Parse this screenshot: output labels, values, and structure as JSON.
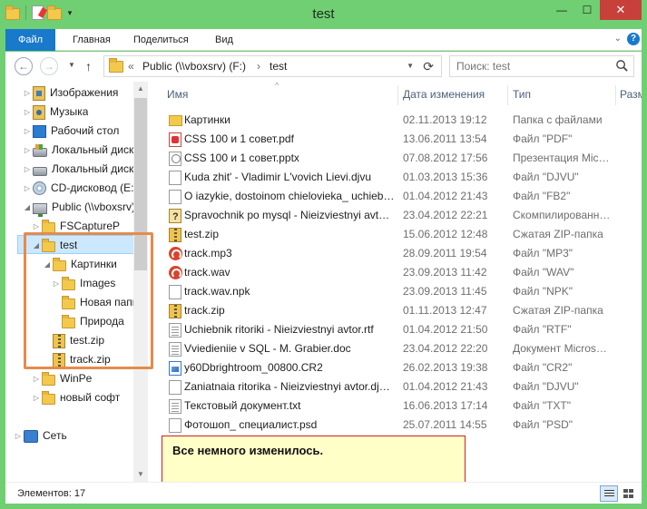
{
  "window": {
    "title": "test",
    "minimize": "—",
    "maximize": "☐",
    "close": "✕"
  },
  "ribbon": {
    "tabs": [
      "Файл",
      "Главная",
      "Поделиться",
      "Вид"
    ],
    "help": "?"
  },
  "address": {
    "prefix": "«",
    "segments": [
      "Public (\\\\vboxsrv) (F:)",
      "test"
    ],
    "separator": "›"
  },
  "search": {
    "placeholder": "Поиск: test"
  },
  "tree": [
    {
      "label": "Изображения",
      "icon": "pictures-library-icon",
      "arrow": "▷",
      "level": 1
    },
    {
      "label": "Музыка",
      "icon": "music-library-icon",
      "arrow": "▷",
      "level": 1
    },
    {
      "label": "Рабочий стол",
      "icon": "desktop-icon",
      "arrow": "▷",
      "level": 1
    },
    {
      "label": "Локальный диск",
      "icon": "local-disk-icon",
      "arrow": "▷",
      "level": 1
    },
    {
      "label": "Локальный диск",
      "icon": "local-disk-icon",
      "arrow": "▷",
      "level": 1
    },
    {
      "label": "CD-дисковод (E:)",
      "icon": "cd-drive-icon",
      "arrow": "▷",
      "level": 1
    },
    {
      "label": "Public (\\\\vboxsrv)",
      "icon": "network-drive-icon",
      "arrow": "◢",
      "level": 1
    },
    {
      "label": "FSCaptureP",
      "icon": "folder-icon",
      "arrow": "▷",
      "level": 2
    },
    {
      "label": "test",
      "icon": "folder-icon",
      "arrow": "◢",
      "level": 2
    },
    {
      "label": "Картинки",
      "icon": "folder-icon",
      "arrow": "◢",
      "level": 3
    },
    {
      "label": "Images",
      "icon": "folder-icon",
      "arrow": "▷",
      "level": 4
    },
    {
      "label": "Новая папка",
      "icon": "folder-icon",
      "arrow": "",
      "level": 4
    },
    {
      "label": "Природа",
      "icon": "folder-icon",
      "arrow": "",
      "level": 4
    },
    {
      "label": "test.zip",
      "icon": "zip-icon",
      "arrow": "",
      "level": 3
    },
    {
      "label": "track.zip",
      "icon": "zip-icon",
      "arrow": "",
      "level": 3
    },
    {
      "label": "WinPe",
      "icon": "folder-icon",
      "arrow": "▷",
      "level": 2
    },
    {
      "label": "новый софт",
      "icon": "folder-icon",
      "arrow": "▷",
      "level": 2
    },
    {
      "label": "Сеть",
      "icon": "network-icon",
      "arrow": "▷",
      "level": 0
    }
  ],
  "columns": {
    "name": "Имя",
    "date": "Дата изменения",
    "type": "Тип",
    "size": "Разм"
  },
  "files": [
    {
      "name": "Картинки",
      "date": "02.11.2013 19:12",
      "type": "Папка с файлами",
      "icon": "folder-icon"
    },
    {
      "name": "CSS 100 и 1 совет.pdf",
      "date": "13.06.2011 13:54",
      "type": "Файл \"PDF\"",
      "icon": "pdf-icon"
    },
    {
      "name": "CSS 100 и 1 совет.pptx",
      "date": "07.08.2012 17:56",
      "type": "Презентация Mic…",
      "icon": "pptx-icon"
    },
    {
      "name": "Kuda zhit' - Vladimir L'vovich Lievi.djvu",
      "date": "01.03.2013 15:36",
      "type": "Файл \"DJVU\"",
      "icon": "document-icon"
    },
    {
      "name": "O iazykie, dostoinom chielovieka_ uchieb…",
      "date": "01.04.2012 21:43",
      "type": "Файл \"FB2\"",
      "icon": "document-icon"
    },
    {
      "name": "Spravochnik po mysql - Nieizviestnyi avt…",
      "date": "23.04.2012 22:21",
      "type": "Скомпилированн…",
      "icon": "chm-help-icon"
    },
    {
      "name": "test.zip",
      "date": "15.06.2012 12:48",
      "type": "Сжатая ZIP-папка",
      "icon": "zip-icon"
    },
    {
      "name": "track.mp3",
      "date": "28.09.2011 19:54",
      "type": "Файл \"MP3\"",
      "icon": "audio-icon"
    },
    {
      "name": "track.wav",
      "date": "23.09.2013 11:42",
      "type": "Файл \"WAV\"",
      "icon": "audio-icon"
    },
    {
      "name": "track.wav.npk",
      "date": "23.09.2013 11:45",
      "type": "Файл \"NPK\"",
      "icon": "document-icon"
    },
    {
      "name": "track.zip",
      "date": "01.11.2013 12:47",
      "type": "Сжатая ZIP-папка",
      "icon": "zip-icon"
    },
    {
      "name": "Uchiebnik ritoriki - Nieizviestnyi avtor.rtf",
      "date": "01.04.2012 21:50",
      "type": "Файл \"RTF\"",
      "icon": "rtf-icon"
    },
    {
      "name": "Vviedieniie v SQL - M. Grabier.doc",
      "date": "23.04.2012 22:20",
      "type": "Документ Micros…",
      "icon": "rtf-icon"
    },
    {
      "name": "y60Dbrightroom_00800.CR2",
      "date": "26.02.2013 19:38",
      "type": "Файл \"CR2\"",
      "icon": "image-icon"
    },
    {
      "name": "Zaniatnaia ritorika - Nieizviestnyi avtor.dj…",
      "date": "01.04.2012 21:43",
      "type": "Файл \"DJVU\"",
      "icon": "document-icon"
    },
    {
      "name": "Текстовый документ.txt",
      "date": "16.06.2013 17:14",
      "type": "Файл \"TXT\"",
      "icon": "rtf-icon"
    },
    {
      "name": "Фотошоп_ специалист.psd",
      "date": "25.07.2011 14:55",
      "type": "Файл \"PSD\"",
      "icon": "document-icon"
    }
  ],
  "callout": {
    "text": "Все немного изменилось."
  },
  "status": {
    "items_text": "Элементов: 17"
  }
}
